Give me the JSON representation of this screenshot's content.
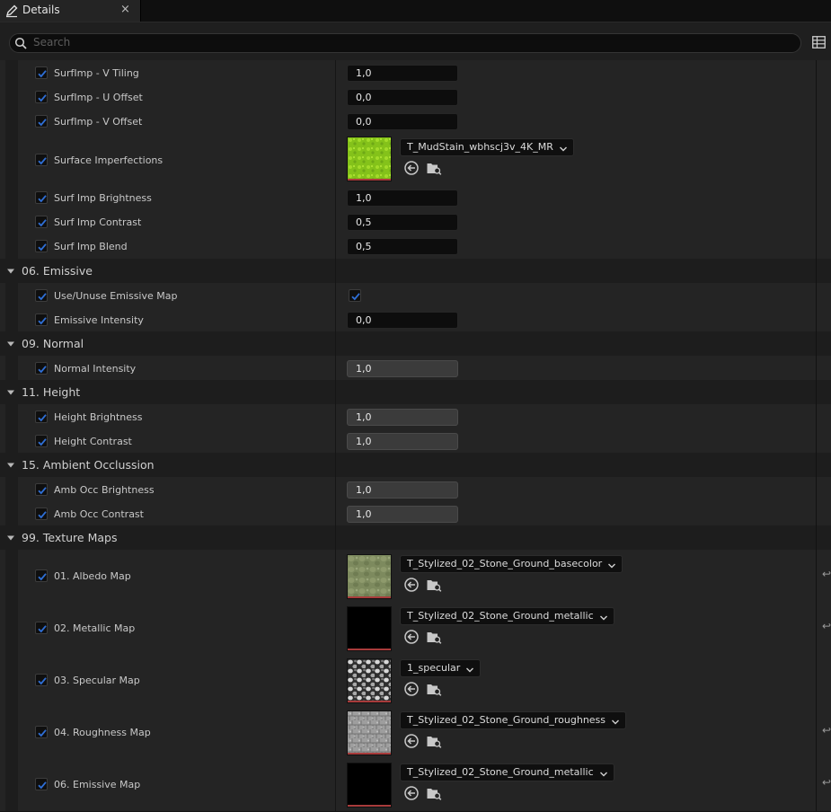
{
  "tab": {
    "title": "Details",
    "close": "×"
  },
  "search": {
    "placeholder": "Search",
    "value": ""
  },
  "rows": {
    "r1": {
      "label": "SurfImp - V Tiling",
      "value": "1,0"
    },
    "r2": {
      "label": "SurfImp - U Offset",
      "value": "0,0"
    },
    "r3": {
      "label": "SurfImp - V Offset",
      "value": "0,0"
    },
    "r4": {
      "label": "Surface Imperfections",
      "asset": "T_MudStain_wbhscj3v_4K_MR"
    },
    "r5": {
      "label": "Surf Imp Brightness",
      "value": "1,0"
    },
    "r6": {
      "label": "Surf Imp Contrast",
      "value": "0,5"
    },
    "r7": {
      "label": "Surf Imp Blend",
      "value": "0,5"
    },
    "s1": {
      "title": "06. Emissive"
    },
    "r8": {
      "label": "Use/Unuse Emissive Map"
    },
    "r9": {
      "label": "Emissive Intensity",
      "value": "0,0"
    },
    "s2": {
      "title": "09. Normal"
    },
    "r10": {
      "label": "Normal Intensity",
      "value": "1,0"
    },
    "s3": {
      "title": "11. Height"
    },
    "r11": {
      "label": "Height Brightness",
      "value": "1,0"
    },
    "r12": {
      "label": "Height Contrast",
      "value": "1,0"
    },
    "s4": {
      "title": "15. Ambient Occlussion"
    },
    "r13": {
      "label": "Amb Occ Brightness",
      "value": "1,0"
    },
    "r14": {
      "label": "Amb Occ Contrast",
      "value": "1,0"
    },
    "s5": {
      "title": "99. Texture Maps"
    },
    "r15": {
      "label": "01. Albedo Map",
      "asset": "T_Stylized_02_Stone_Ground_basecolor"
    },
    "r16": {
      "label": "02. Metallic Map",
      "asset": "T_Stylized_02_Stone_Ground_metallic"
    },
    "r17": {
      "label": "03. Specular Map",
      "asset": "1_specular"
    },
    "r18": {
      "label": "04. Roughness Map",
      "asset": "T_Stylized_02_Stone_Ground_roughness"
    },
    "r19": {
      "label": "06. Emissive Map",
      "asset": "T_Stylized_02_Stone_Ground_metallic"
    }
  },
  "reset_glyph": "↩",
  "colors": {
    "accent": "#2f6fd6",
    "panel": "#242424",
    "background": "#151515"
  }
}
